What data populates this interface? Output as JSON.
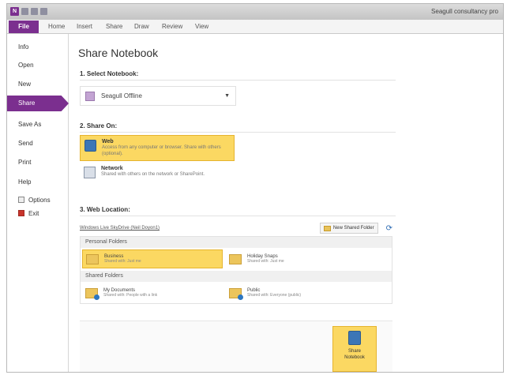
{
  "app": {
    "app_icon_letter": "N",
    "window_title": "Seagull consultancy pro"
  },
  "ribbon": {
    "file_tab": "File",
    "tabs": [
      "Home",
      "Insert",
      "Share",
      "Draw",
      "Review",
      "View"
    ]
  },
  "nav": {
    "items": [
      "Info",
      "Open",
      "New",
      "Share",
      "Save As",
      "Send",
      "Print",
      "Help",
      "Options",
      "Exit"
    ],
    "active": "Share"
  },
  "page": {
    "title": "Share Notebook",
    "section1": "1. Select Notebook:",
    "notebook_value": "Seagull Offline",
    "section2": "2. Share On:",
    "share_options": [
      {
        "title": "Web",
        "desc": "Access from any computer or browser. Share with others (optional)."
      },
      {
        "title": "Network",
        "desc": "Shared with others on the network or SharePoint."
      }
    ],
    "section3": "3. Web Location:",
    "location_link": "Windows Live SkyDrive (Neil Doyon1)",
    "new_folder_label": "New Shared Folder",
    "groups": [
      {
        "header": "Personal Folders",
        "folders": [
          {
            "name": "Business",
            "desc": "Shared with: Just me"
          },
          {
            "name": "Holiday Snaps",
            "desc": "Shared with: Just me"
          }
        ]
      },
      {
        "header": "Shared Folders",
        "folders": [
          {
            "name": "My Documents",
            "desc": "Shared with: People with a link"
          },
          {
            "name": "Public",
            "desc": "Shared with: Everyone (public)"
          }
        ]
      }
    ],
    "share_button_line1": "Share",
    "share_button_line2": "Notebook"
  },
  "colors": {
    "accent": "#7b2f8f",
    "selected": "#fbd862"
  },
  "icons": [
    "app-icon",
    "options-icon",
    "exit-icon",
    "notebook-icon",
    "chevron-down-icon",
    "globe-icon",
    "network-icon",
    "folder-icon",
    "refresh-icon",
    "share-notebook-icon"
  ]
}
